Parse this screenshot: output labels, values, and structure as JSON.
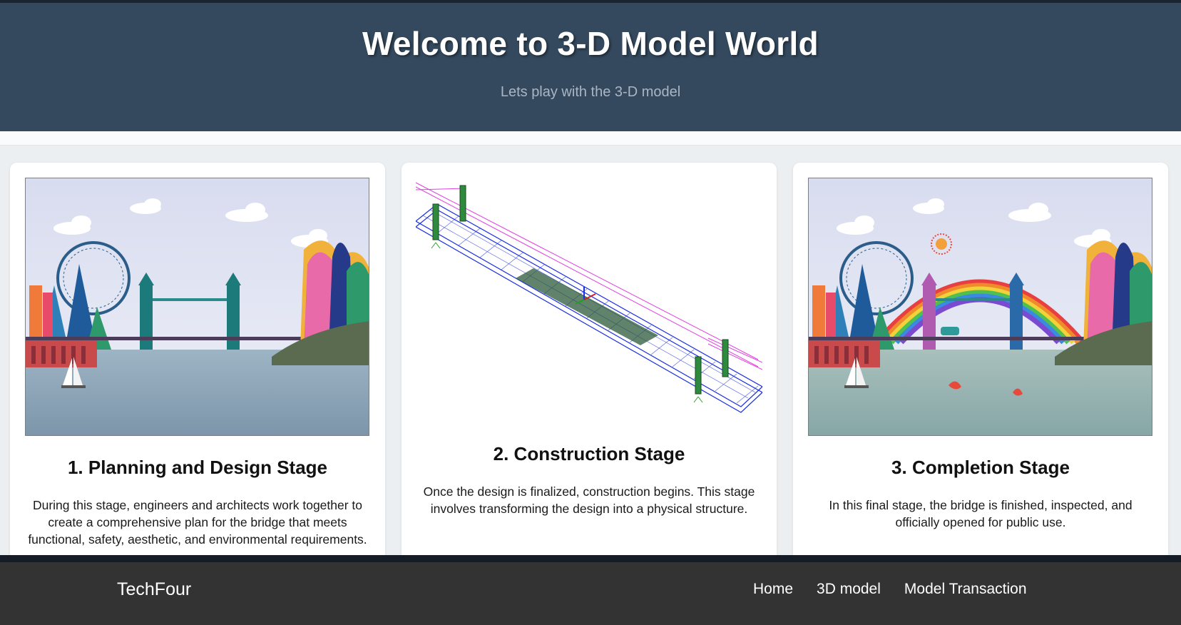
{
  "hero": {
    "title": "Welcome to 3-D Model World",
    "subtitle": "Lets play with the 3-D model"
  },
  "cards": [
    {
      "illustration": "london-bridge-planning-illustration",
      "title": "1. Planning and Design Stage",
      "description": "During this stage, engineers and architects work together to create a comprehensive plan for the bridge that meets functional, safety, aesthetic, and environmental requirements."
    },
    {
      "illustration": "bridge-3d-construction-model",
      "title": "2. Construction Stage",
      "description": "Once the design is finalized, construction begins. This stage involves transforming the design into a physical structure."
    },
    {
      "illustration": "london-bridge-rainbow-completion-illustration",
      "title": "3. Completion Stage",
      "description": "In this final stage, the bridge is finished, inspected, and officially opened for public use."
    }
  ],
  "footer": {
    "brand": "TechFour",
    "nav": [
      "Home",
      "3D model",
      "Model Transaction"
    ]
  },
  "colors": {
    "hero_bg": "#34495e",
    "page_bg": "#eceff1",
    "footer_bg": "#333333",
    "model_blue": "#1c2fe0",
    "model_magenta": "#e040e0"
  }
}
